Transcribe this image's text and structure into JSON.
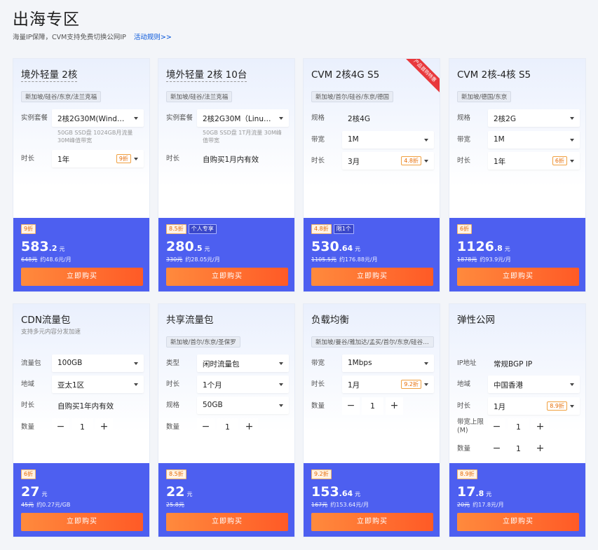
{
  "page": {
    "title": "出海专区",
    "subtitle": "海量IP保障，CVM支持免费切换公网IP",
    "rules_link": "活动规则>>"
  },
  "colors": {
    "price_panel": "#4d5ff0",
    "buy_button": "#ff6a30",
    "accent_link": "#0052d9",
    "discount_text": "#e66a00"
  },
  "cards": [
    {
      "name": "境外轻量 2核",
      "region": "新加坡/硅谷/东京/法兰克福",
      "spec_label": "实例套餐",
      "spec_value": "2核2G30M(Windo…",
      "spec_note": "50GB SSD盘 1024GB月流量 30M峰值带宽",
      "duration_label": "时长",
      "duration_value": "1年",
      "duration_discount": "9折",
      "discount": "9折",
      "price_int": "583",
      "price_dec": ".2",
      "price_unit": "元",
      "orig_price": "648元",
      "monthly": "约48.6元/月",
      "buy_label": "立即购买"
    },
    {
      "name": "境外轻量 2核 10台",
      "region": "新加坡/硅谷/法兰克福",
      "spec_label": "实例套餐",
      "spec_value": "2核2G30M（Linu…",
      "spec_note": "50GB SSD盘 1T月流量 30M峰值带宽",
      "duration_label": "时长",
      "duration_value": "自购买1月内有效",
      "discount": "8.5折",
      "tag": "个人专享",
      "price_int": "280",
      "price_dec": ".5",
      "price_unit": "元",
      "orig_price": "330元",
      "monthly": "约28.05元/月",
      "buy_label": "立即购买"
    },
    {
      "name": "CVM 2核4G S5",
      "region": "新加坡/首尔/硅谷/东京/德国",
      "ribbon": "产品首购特惠",
      "spec_label": "规格",
      "spec_value": "2核4G",
      "bandwidth_label": "带宽",
      "bandwidth_value": "1M",
      "duration_label": "时长",
      "duration_value": "3月",
      "duration_discount": "4.8折",
      "discount": "4.8折",
      "tag": "限1个",
      "price_int": "530",
      "price_dec": ".64",
      "price_unit": "元",
      "orig_price": "1105.5元",
      "monthly": "约176.88元/月",
      "buy_label": "立即购买"
    },
    {
      "name": "CVM 2核-4核 S5",
      "region": "新加坡/德国/东京",
      "spec_label": "规格",
      "spec_value": "2核2G",
      "bandwidth_label": "带宽",
      "bandwidth_value": "1M",
      "duration_label": "时长",
      "duration_value": "1年",
      "duration_discount": "6折",
      "discount": "6折",
      "price_int": "1126",
      "price_dec": ".8",
      "price_unit": "元",
      "orig_price": "1878元",
      "monthly": "约93.9元/月",
      "buy_label": "立即购买"
    },
    {
      "name": "CDN流量包",
      "desc": "支持多元内容分发加速",
      "pack_label": "流量包",
      "pack_value": "100GB",
      "area_label": "地域",
      "area_value": "亚太1区",
      "duration_label": "时长",
      "duration_value": "自购买1年内有效",
      "qty_label": "数量",
      "qty_value": "1",
      "minus": "−",
      "plus": "+",
      "discount": "6折",
      "price_int": "27",
      "price_dec": "",
      "price_unit": "元",
      "orig_price": "45元",
      "monthly": "约0.27元/GB",
      "buy_label": "立即购买"
    },
    {
      "name": "共享流量包",
      "region": "新加坡/首尔/东京/圣保罗",
      "type_label": "类型",
      "type_value": "闲时流量包",
      "duration_label": "时长",
      "duration_value": "1个月",
      "spec_label": "规格",
      "spec_value": "50GB",
      "qty_label": "数量",
      "qty_value": "1",
      "minus": "−",
      "plus": "+",
      "discount": "8.5折",
      "price_int": "22",
      "price_dec": "",
      "price_unit": "元",
      "orig_price": "25.8元",
      "monthly": "",
      "buy_label": "立即购买"
    },
    {
      "name": "负载均衡",
      "region": "新加坡/曼谷/雅加达/孟买/首尔/东京/硅谷/…",
      "bandwidth_label": "带宽",
      "bandwidth_value": "1Mbps",
      "duration_label": "时长",
      "duration_value": "1月",
      "duration_discount": "9.2折",
      "qty_label": "数量",
      "qty_value": "1",
      "minus": "−",
      "plus": "+",
      "discount": "9.2折",
      "price_int": "153",
      "price_dec": ".64",
      "price_unit": "元",
      "orig_price": "167元",
      "monthly": "约153.64元/月",
      "buy_label": "立即购买"
    },
    {
      "name": "弹性公网",
      "ip_label": "IP地址",
      "ip_value": "常规BGP IP",
      "area_label": "地域",
      "area_value": "中国香港",
      "duration_label": "时长",
      "duration_value": "1月",
      "duration_discount": "8.9折",
      "bw_label": "带宽上限(M)",
      "bw_value": "1",
      "qty_label": "数量",
      "qty_value": "1",
      "minus": "−",
      "plus": "+",
      "discount": "8.9折",
      "price_int": "17",
      "price_dec": ".8",
      "price_unit": "元",
      "orig_price": "20元",
      "monthly": "约17.8元/月",
      "buy_label": "立即购买"
    }
  ]
}
